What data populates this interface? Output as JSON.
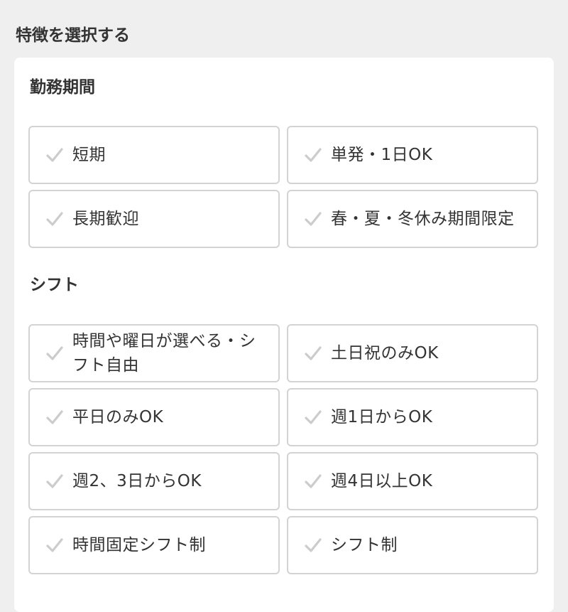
{
  "page": {
    "title": "特徴を選択する"
  },
  "colors": {
    "background": "#efefef",
    "panel": "#ffffff",
    "border": "#d3d3d3",
    "check": "#cccccc",
    "text": "#333333"
  },
  "sections": [
    {
      "title": "勤務期間",
      "options": [
        {
          "label": "短期",
          "icon": "check-icon"
        },
        {
          "label": "単発・1日OK",
          "icon": "check-icon"
        },
        {
          "label": "長期歓迎",
          "icon": "check-icon"
        },
        {
          "label": "春・夏・冬休み期間限定",
          "icon": "check-icon"
        }
      ]
    },
    {
      "title": "シフト",
      "options": [
        {
          "label": "時間や曜日が選べる・シフト自由",
          "icon": "check-icon"
        },
        {
          "label": "土日祝のみOK",
          "icon": "check-icon"
        },
        {
          "label": "平日のみOK",
          "icon": "check-icon"
        },
        {
          "label": "週1日からOK",
          "icon": "check-icon"
        },
        {
          "label": "週2、3日からOK",
          "icon": "check-icon"
        },
        {
          "label": "週4日以上OK",
          "icon": "check-icon"
        },
        {
          "label": "時間固定シフト制",
          "icon": "check-icon"
        },
        {
          "label": "シフト制",
          "icon": "check-icon"
        }
      ]
    }
  ]
}
